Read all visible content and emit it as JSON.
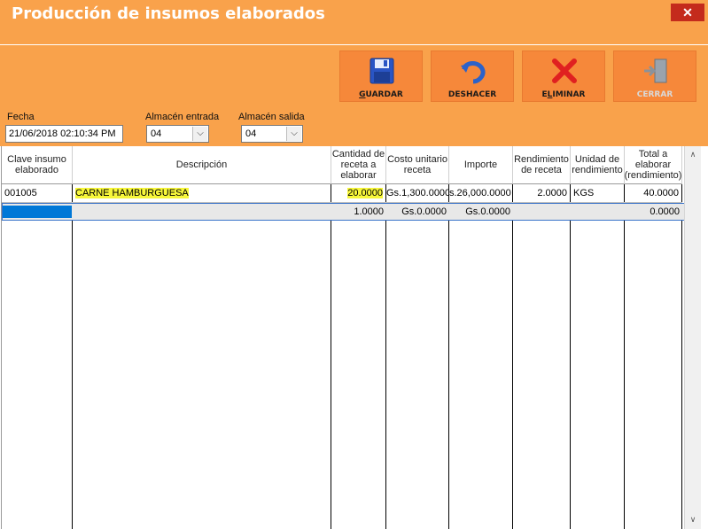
{
  "window": {
    "title": "Producción de insumos elaborados",
    "close_label": "✕"
  },
  "toolbar": {
    "guardar": {
      "label": "GUARDAR",
      "icon": "floppy-disk-icon"
    },
    "deshacer": {
      "label": "DESHACER",
      "icon": "undo-icon"
    },
    "eliminar": {
      "label": "ELIMINAR",
      "icon": "delete-x-icon"
    },
    "cerrar": {
      "label": "CERRAR",
      "icon": "exit-door-icon",
      "disabled": true
    }
  },
  "filters": {
    "fecha_label": "Fecha",
    "fecha_value": "21/06/2018 02:10:34 PM",
    "almacen_entrada_label": "Almacén entrada",
    "almacen_entrada_value": "04",
    "almacen_salida_label": "Almacén salida",
    "almacen_salida_value": "04"
  },
  "table": {
    "headers": {
      "clave": "Clave insumo elaborado",
      "descripcion": "Descripción",
      "cantidad": "Cantidad de receta a elaborar",
      "costo": "Costo unitario receta",
      "importe": "Importe",
      "rendimiento": "Rendimiento de receta",
      "unidad": "Unidad de rendimiento",
      "total": "Total a elaborar (rendimiento)"
    },
    "rows": [
      {
        "clave": "001005",
        "descripcion": "CARNE HAMBURGUESA",
        "cantidad": "20.0000",
        "costo": "Gs.1,300.0000",
        "importe": "s.26,000.0000",
        "rendimiento": "2.0000",
        "unidad": "KGS",
        "total": "40.0000"
      },
      {
        "clave": "",
        "descripcion": "",
        "cantidad": "1.0000",
        "costo": "Gs.0.0000",
        "importe": "Gs.0.0000",
        "rendimiento": "",
        "unidad": "",
        "total": "0.0000"
      }
    ]
  },
  "colors": {
    "accent": "#f9a24b",
    "button": "#f6883a",
    "highlight": "#f7f73a",
    "selection": "#0078d7"
  }
}
